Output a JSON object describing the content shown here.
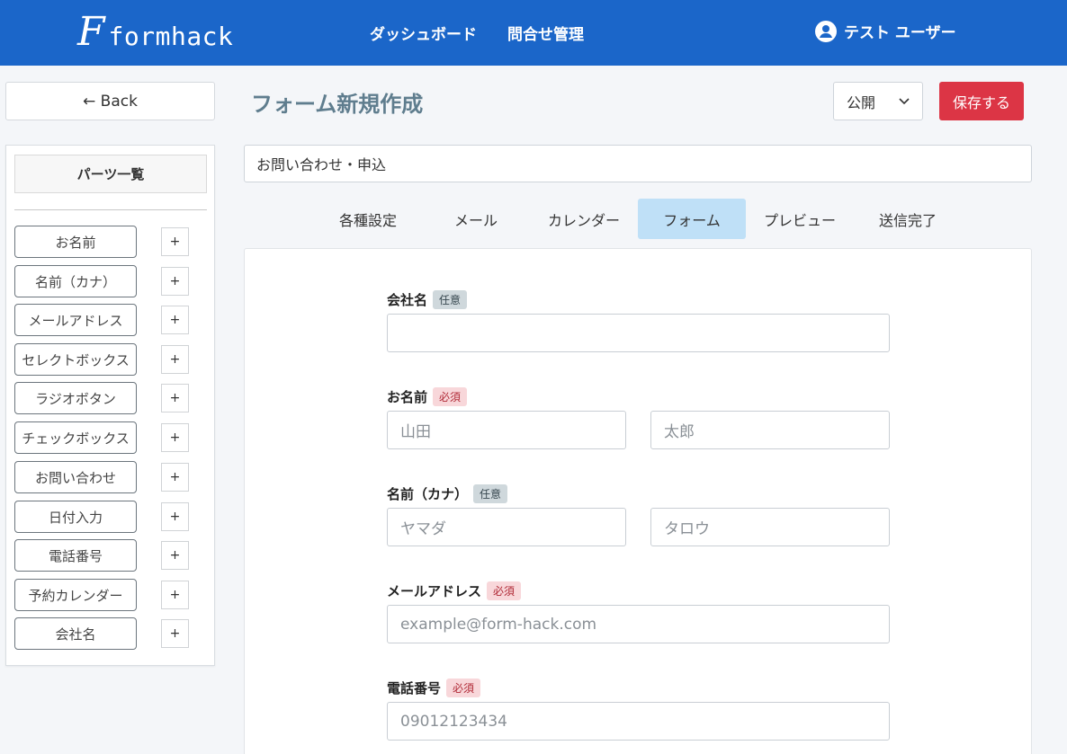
{
  "header": {
    "logo_mark": "F",
    "logo_text": "formhack",
    "nav": [
      "ダッシュボード",
      "問合せ管理"
    ],
    "user_name": "テスト ユーザー",
    "bg_color": "#1b66c9"
  },
  "back_label": "← Back",
  "page_title": "フォーム新規作成",
  "publish_status": "公開",
  "save_label": "保存する",
  "sidebar": {
    "title": "パーツ一覧",
    "add_label": "+",
    "parts": [
      "お名前",
      "名前（カナ）",
      "メールアドレス",
      "セレクトボックス",
      "ラジオボタン",
      "チェックボックス",
      "お問い合わせ",
      "日付入力",
      "電話番号",
      "予約カレンダー",
      "会社名"
    ]
  },
  "form_name": "お問い合わせ・申込",
  "tabs": [
    "各種設定",
    "メール",
    "カレンダー",
    "フォーム",
    "プレビュー",
    "送信完了"
  ],
  "active_tab": "フォーム",
  "fields": [
    {
      "label": "会社名",
      "badge": "任意",
      "required": false,
      "inputs": [
        ""
      ]
    },
    {
      "label": "お名前",
      "badge": "必須",
      "required": true,
      "inputs": [
        "山田",
        "太郎"
      ]
    },
    {
      "label": "名前（カナ）",
      "badge": "任意",
      "required": false,
      "inputs": [
        "ヤマダ",
        "タロウ"
      ]
    },
    {
      "label": "メールアドレス",
      "badge": "必須",
      "required": true,
      "inputs": [
        "example@form-hack.com"
      ]
    },
    {
      "label": "電話番号",
      "badge": "必須",
      "required": true,
      "inputs": [
        "09012123434"
      ]
    }
  ]
}
